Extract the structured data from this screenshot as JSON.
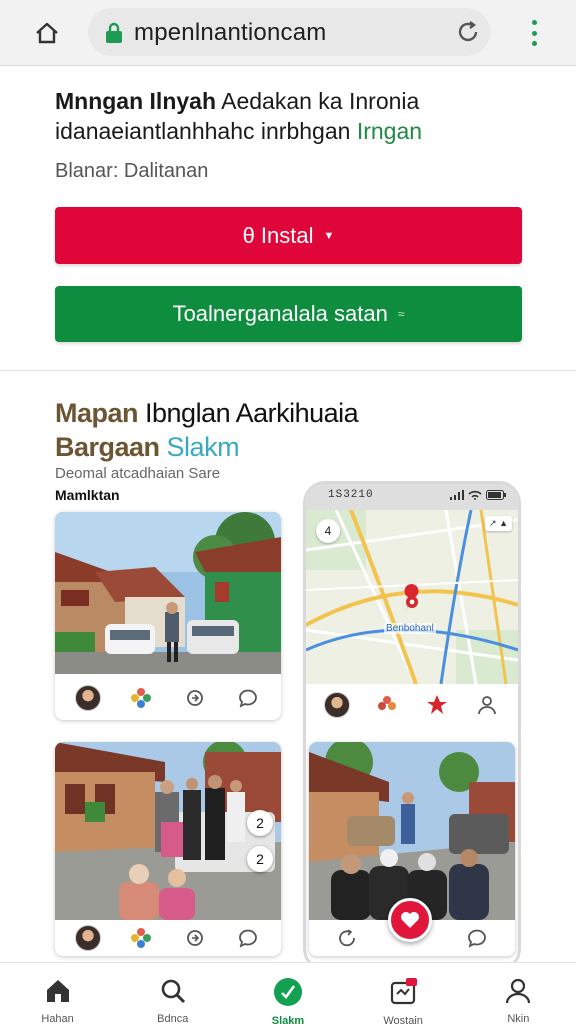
{
  "browser": {
    "url": "mpenlnantioncam"
  },
  "header": {
    "headline_bold": "Mnngan Ilnyah",
    "headline_rest": " Aedakan ka Inronia",
    "headline_line2": "idanaeiantlanhhahc inrbhgan",
    "headline_green": "Irngan",
    "subline": "Blanar: Dalitanan"
  },
  "buttons": {
    "install_icon": "θ",
    "install_label": "Instal",
    "primary_label": "Toalnerganalala satan",
    "primary_suffix": "≈"
  },
  "section": {
    "title_brown1": "Mapan",
    "title_dark": " Ibnglan Aarkihuaia",
    "title_brown2": "Bargaan",
    "title_teal": " Slakm",
    "description": "Deomal atcadhaian Sare",
    "label": "Mamlktan"
  },
  "phone": {
    "time": "1S3210",
    "map_label": "Benbohanl",
    "map_badge": "4",
    "map_pill": "↗ ▲"
  },
  "cards": {
    "badge_top": "2",
    "badge_bottom": "2"
  },
  "nav": [
    {
      "label": "Hahan",
      "icon": "home-icon"
    },
    {
      "label": "Bdnca",
      "icon": "search-icon"
    },
    {
      "label": "Slakm",
      "icon": "check-icon"
    },
    {
      "label": "Wostain",
      "icon": "notification-icon"
    },
    {
      "label": "Nkin",
      "icon": "profile-icon"
    }
  ],
  "colors": {
    "install_red": "#e1063a",
    "primary_green": "#0f8d3e",
    "accent_teal": "#3aa9bd",
    "accent_brown": "#6b5532"
  }
}
